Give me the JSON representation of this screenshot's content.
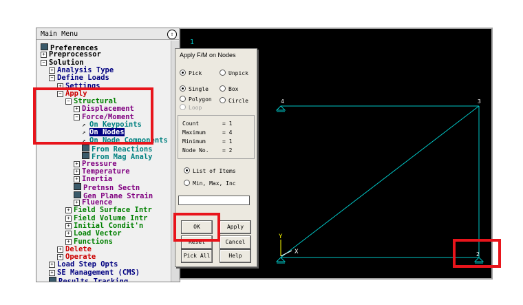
{
  "menu": {
    "title": "Main Menu",
    "collapse_glyph": "Ⓐ",
    "items": [
      {
        "label": "Preferences",
        "icon": "doc",
        "color": "#000000"
      },
      {
        "label": "Preprocessor",
        "icon": "plus",
        "color": "#000000"
      },
      {
        "label": "Solution",
        "icon": "minus",
        "color": "#000000"
      },
      {
        "label": "Analysis Type",
        "icon": "plus",
        "color": "#000080"
      },
      {
        "label": "Define Loads",
        "icon": "minus",
        "color": "#000080"
      },
      {
        "label": "Settings",
        "icon": "plus",
        "color": "#000080"
      },
      {
        "label": "Apply",
        "icon": "minus",
        "color": "#cc0000"
      },
      {
        "label": "Structural",
        "icon": "minus",
        "color": "#008000"
      },
      {
        "label": "Displacement",
        "icon": "plus",
        "color": "#800080"
      },
      {
        "label": "Force/Moment",
        "icon": "minus",
        "color": "#800080"
      },
      {
        "label": "On Keypoints",
        "icon": "arrow",
        "color": "#008080"
      },
      {
        "label": "On Nodes",
        "icon": "arrow",
        "color": "#ffffff",
        "selected": true
      },
      {
        "label": "On Node Components",
        "icon": "arrow",
        "color": "#008080"
      },
      {
        "label": "From Reactions",
        "icon": "doc",
        "color": "#008080"
      },
      {
        "label": "From Mag Analy",
        "icon": "doc",
        "color": "#008080"
      },
      {
        "label": "Pressure",
        "icon": "plus",
        "color": "#800080"
      },
      {
        "label": "Temperature",
        "icon": "plus",
        "color": "#800080"
      },
      {
        "label": "Inertia",
        "icon": "plus",
        "color": "#800080"
      },
      {
        "label": "Pretnsn Sectn",
        "icon": "doc",
        "color": "#800080"
      },
      {
        "label": "Gen Plane Strain",
        "icon": "doc",
        "color": "#800080"
      },
      {
        "label": "Fluence",
        "icon": "plus",
        "color": "#800080"
      },
      {
        "label": "Field Surface Intr",
        "icon": "plus",
        "color": "#008000"
      },
      {
        "label": "Field Volume Intr",
        "icon": "plus",
        "color": "#008000"
      },
      {
        "label": "Initial Condit'n",
        "icon": "plus",
        "color": "#008000"
      },
      {
        "label": "Load Vector",
        "icon": "plus",
        "color": "#008000"
      },
      {
        "label": "Functions",
        "icon": "plus",
        "color": "#008000"
      },
      {
        "label": "Delete",
        "icon": "plus",
        "color": "#cc0000"
      },
      {
        "label": "Operate",
        "icon": "plus",
        "color": "#cc0000"
      },
      {
        "label": "Load Step Opts",
        "icon": "plus",
        "color": "#000080"
      },
      {
        "label": "SE Management (CMS)",
        "icon": "plus",
        "color": "#000080"
      },
      {
        "label": "Results Tracking",
        "icon": "doc",
        "color": "#000080"
      }
    ]
  },
  "dialog": {
    "title": "Apply F/M on Nodes",
    "pick": "Pick",
    "unpick": "Unpick",
    "single": "Single",
    "box": "Box",
    "polygon": "Polygon",
    "circle": "Circle",
    "loop": "Loop",
    "count_label": "Count",
    "count": "= 1",
    "maximum_label": "Maximum",
    "maximum": "= 4",
    "minimum_label": "Minimum",
    "minimum": "= 1",
    "nodeno_label": "Node No.",
    "nodeno": "= 2",
    "list_items": "List of Items",
    "min_max_inc": "Min, Max, Inc",
    "input_value": "",
    "ok": "OK",
    "apply": "Apply",
    "reset": "Reset",
    "cancel": "Cancel",
    "pick_all": "Pick All",
    "help": "Help"
  },
  "graphics": {
    "window_number": "1",
    "node_labels": [
      "4",
      "3",
      "2"
    ],
    "axis_y": "Y",
    "axis_x": "X",
    "line_color": "#00c8c8",
    "background": "#000000"
  },
  "highlight_color": "#e8141b"
}
